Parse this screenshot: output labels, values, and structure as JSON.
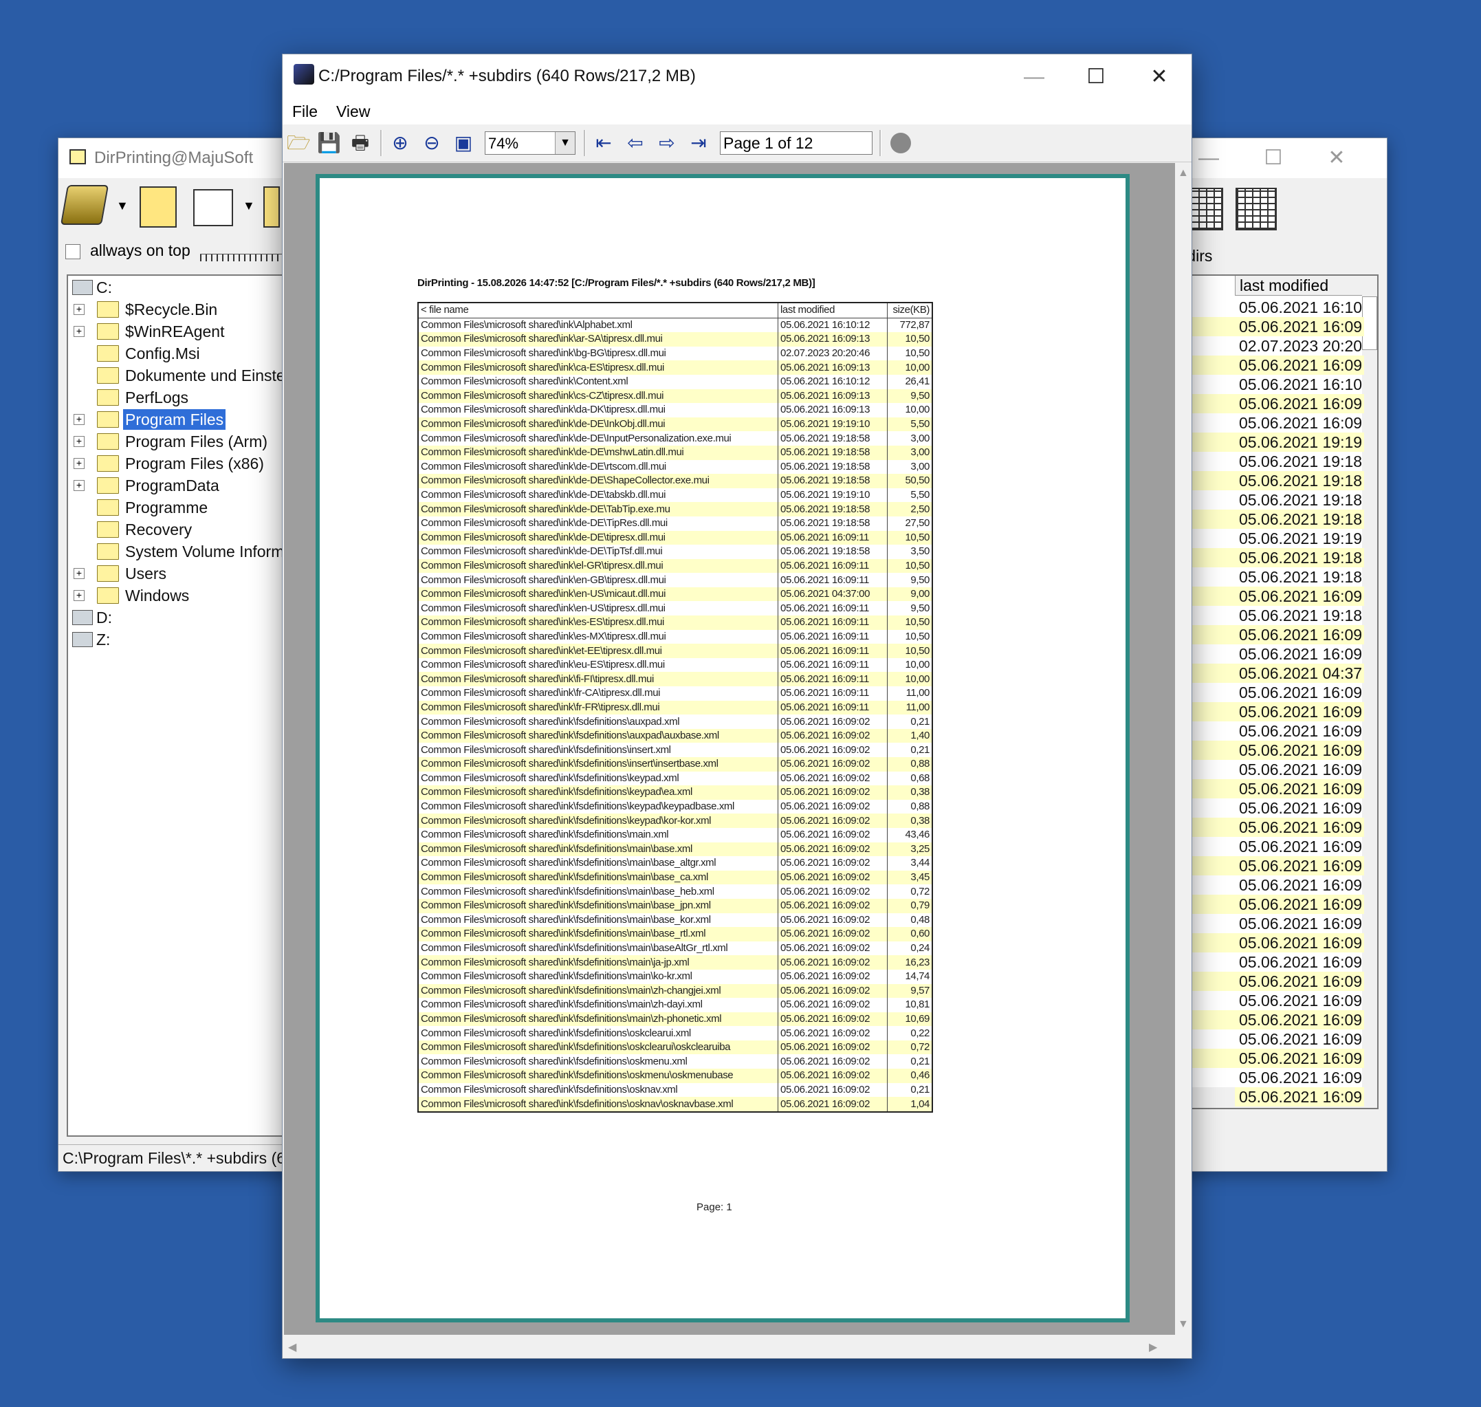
{
  "left_window": {
    "title": "DirPrinting@MajuSoft",
    "always_on_top": "allways on top",
    "status": "C:\\Program Files\\*.* +subdirs (640",
    "tree": [
      {
        "label": "C:",
        "type": "drive"
      },
      {
        "label": "$Recycle.Bin",
        "expandable": true
      },
      {
        "label": "$WinREAgent",
        "expandable": true
      },
      {
        "label": "Config.Msi",
        "expandable": false
      },
      {
        "label": "Dokumente und Einstellu",
        "expandable": false
      },
      {
        "label": "PerfLogs",
        "expandable": false
      },
      {
        "label": "Program Files",
        "expandable": true,
        "selected": true
      },
      {
        "label": "Program Files (Arm)",
        "expandable": true
      },
      {
        "label": "Program Files (x86)",
        "expandable": true
      },
      {
        "label": "ProgramData",
        "expandable": true
      },
      {
        "label": "Programme",
        "expandable": false
      },
      {
        "label": "Recovery",
        "expandable": false
      },
      {
        "label": "System Volume Informati",
        "expandable": false
      },
      {
        "label": "Users",
        "expandable": true
      },
      {
        "label": "Windows",
        "expandable": true
      },
      {
        "label": "D:",
        "type": "drive"
      },
      {
        "label": "Z:",
        "type": "drive"
      }
    ]
  },
  "right_window": {
    "search_label": "earch in subdirs",
    "column_header": "last modified",
    "dates": [
      "05.06.2021 16:10",
      "05.06.2021 16:09",
      "02.07.2023 20:20",
      "05.06.2021 16:09",
      "05.06.2021 16:10",
      "05.06.2021 16:09",
      "05.06.2021 16:09",
      "05.06.2021 19:19",
      "05.06.2021 19:18",
      "05.06.2021 19:18",
      "05.06.2021 19:18",
      "05.06.2021 19:18",
      "05.06.2021 19:19",
      "05.06.2021 19:18",
      "05.06.2021 19:18",
      "05.06.2021 16:09",
      "05.06.2021 19:18",
      "05.06.2021 16:09",
      "05.06.2021 16:09",
      "05.06.2021 04:37",
      "05.06.2021 16:09",
      "05.06.2021 16:09",
      "05.06.2021 16:09",
      "05.06.2021 16:09",
      "05.06.2021 16:09",
      "05.06.2021 16:09",
      "05.06.2021 16:09",
      "05.06.2021 16:09",
      "05.06.2021 16:09",
      "05.06.2021 16:09",
      "05.06.2021 16:09",
      "05.06.2021 16:09",
      "05.06.2021 16:09",
      "05.06.2021 16:09",
      "05.06.2021 16:09",
      "05.06.2021 16:09",
      "05.06.2021 16:09",
      "05.06.2021 16:09",
      "05.06.2021 16:09",
      "05.06.2021 16:09",
      "05.06.2021 16:09",
      "05.06.2021 16:09"
    ],
    "fragments": [
      {
        "row": 8,
        "text": "mui"
      },
      {
        "row": 29,
        "text": "nl"
      },
      {
        "row": 31,
        "text": "nl"
      },
      {
        "row": 34,
        "text": "e.xml"
      },
      {
        "row": 38,
        "text": "l"
      }
    ]
  },
  "main_window": {
    "title": "C:/Program Files/*.* +subdirs (640 Rows/217,2 MB)",
    "menu": [
      "File",
      "View"
    ],
    "zoom": "74%",
    "page_indicator": "Page 1 of 12",
    "report": {
      "title": "DirPrinting - 15.08.2026 14:47:52 [C:/Program Files/*.* +subdirs (640 Rows/217,2 MB)]",
      "headers": [
        "< file name",
        "last modified",
        "size(KB)"
      ],
      "rows": [
        [
          "Common Files\\microsoft shared\\ink\\Alphabet.xml",
          "05.06.2021 16:10:12",
          "772,87"
        ],
        [
          "Common Files\\microsoft shared\\ink\\ar-SA\\tipresx.dll.mui",
          "05.06.2021 16:09:13",
          "10,50"
        ],
        [
          "Common Files\\microsoft shared\\ink\\bg-BG\\tipresx.dll.mui",
          "02.07.2023 20:20:46",
          "10,50"
        ],
        [
          "Common Files\\microsoft shared\\ink\\ca-ES\\tipresx.dll.mui",
          "05.06.2021 16:09:13",
          "10,00"
        ],
        [
          "Common Files\\microsoft shared\\ink\\Content.xml",
          "05.06.2021 16:10:12",
          "26,41"
        ],
        [
          "Common Files\\microsoft shared\\ink\\cs-CZ\\tipresx.dll.mui",
          "05.06.2021 16:09:13",
          "9,50"
        ],
        [
          "Common Files\\microsoft shared\\ink\\da-DK\\tipresx.dll.mui",
          "05.06.2021 16:09:13",
          "10,00"
        ],
        [
          "Common Files\\microsoft shared\\ink\\de-DE\\InkObj.dll.mui",
          "05.06.2021 19:19:10",
          "5,50"
        ],
        [
          "Common Files\\microsoft shared\\ink\\de-DE\\InputPersonalization.exe.mui",
          "05.06.2021 19:18:58",
          "3,00"
        ],
        [
          "Common Files\\microsoft shared\\ink\\de-DE\\mshwLatin.dll.mui",
          "05.06.2021 19:18:58",
          "3,00"
        ],
        [
          "Common Files\\microsoft shared\\ink\\de-DE\\rtscom.dll.mui",
          "05.06.2021 19:18:58",
          "3,00"
        ],
        [
          "Common Files\\microsoft shared\\ink\\de-DE\\ShapeCollector.exe.mui",
          "05.06.2021 19:18:58",
          "50,50"
        ],
        [
          "Common Files\\microsoft shared\\ink\\de-DE\\tabskb.dll.mui",
          "05.06.2021 19:19:10",
          "5,50"
        ],
        [
          "Common Files\\microsoft shared\\ink\\de-DE\\TabTip.exe.mu",
          "05.06.2021 19:18:58",
          "2,50"
        ],
        [
          "Common Files\\microsoft shared\\ink\\de-DE\\TipRes.dll.mui",
          "05.06.2021 19:18:58",
          "27,50"
        ],
        [
          "Common Files\\microsoft shared\\ink\\de-DE\\tipresx.dll.mui",
          "05.06.2021 16:09:11",
          "10,50"
        ],
        [
          "Common Files\\microsoft shared\\ink\\de-DE\\TipTsf.dll.mui",
          "05.06.2021 19:18:58",
          "3,50"
        ],
        [
          "Common Files\\microsoft shared\\ink\\el-GR\\tipresx.dll.mui",
          "05.06.2021 16:09:11",
          "10,50"
        ],
        [
          "Common Files\\microsoft shared\\ink\\en-GB\\tipresx.dll.mui",
          "05.06.2021 16:09:11",
          "9,50"
        ],
        [
          "Common Files\\microsoft shared\\ink\\en-US\\micaut.dll.mui",
          "05.06.2021 04:37:00",
          "9,00"
        ],
        [
          "Common Files\\microsoft shared\\ink\\en-US\\tipresx.dll.mui",
          "05.06.2021 16:09:11",
          "9,50"
        ],
        [
          "Common Files\\microsoft shared\\ink\\es-ES\\tipresx.dll.mui",
          "05.06.2021 16:09:11",
          "10,50"
        ],
        [
          "Common Files\\microsoft shared\\ink\\es-MX\\tipresx.dll.mui",
          "05.06.2021 16:09:11",
          "10,50"
        ],
        [
          "Common Files\\microsoft shared\\ink\\et-EE\\tipresx.dll.mui",
          "05.06.2021 16:09:11",
          "10,50"
        ],
        [
          "Common Files\\microsoft shared\\ink\\eu-ES\\tipresx.dll.mui",
          "05.06.2021 16:09:11",
          "10,00"
        ],
        [
          "Common Files\\microsoft shared\\ink\\fi-FI\\tipresx.dll.mui",
          "05.06.2021 16:09:11",
          "10,00"
        ],
        [
          "Common Files\\microsoft shared\\ink\\fr-CA\\tipresx.dll.mui",
          "05.06.2021 16:09:11",
          "11,00"
        ],
        [
          "Common Files\\microsoft shared\\ink\\fr-FR\\tipresx.dll.mui",
          "05.06.2021 16:09:11",
          "11,00"
        ],
        [
          "Common Files\\microsoft shared\\ink\\fsdefinitions\\auxpad.xml",
          "05.06.2021 16:09:02",
          "0,21"
        ],
        [
          "Common Files\\microsoft shared\\ink\\fsdefinitions\\auxpad\\auxbase.xml",
          "05.06.2021 16:09:02",
          "1,40"
        ],
        [
          "Common Files\\microsoft shared\\ink\\fsdefinitions\\insert.xml",
          "05.06.2021 16:09:02",
          "0,21"
        ],
        [
          "Common Files\\microsoft shared\\ink\\fsdefinitions\\insert\\insertbase.xml",
          "05.06.2021 16:09:02",
          "0,88"
        ],
        [
          "Common Files\\microsoft shared\\ink\\fsdefinitions\\keypad.xml",
          "05.06.2021 16:09:02",
          "0,68"
        ],
        [
          "Common Files\\microsoft shared\\ink\\fsdefinitions\\keypad\\ea.xml",
          "05.06.2021 16:09:02",
          "0,38"
        ],
        [
          "Common Files\\microsoft shared\\ink\\fsdefinitions\\keypad\\keypadbase.xml",
          "05.06.2021 16:09:02",
          "0,88"
        ],
        [
          "Common Files\\microsoft shared\\ink\\fsdefinitions\\keypad\\kor-kor.xml",
          "05.06.2021 16:09:02",
          "0,38"
        ],
        [
          "Common Files\\microsoft shared\\ink\\fsdefinitions\\main.xml",
          "05.06.2021 16:09:02",
          "43,46"
        ],
        [
          "Common Files\\microsoft shared\\ink\\fsdefinitions\\main\\base.xml",
          "05.06.2021 16:09:02",
          "3,25"
        ],
        [
          "Common Files\\microsoft shared\\ink\\fsdefinitions\\main\\base_altgr.xml",
          "05.06.2021 16:09:02",
          "3,44"
        ],
        [
          "Common Files\\microsoft shared\\ink\\fsdefinitions\\main\\base_ca.xml",
          "05.06.2021 16:09:02",
          "3,45"
        ],
        [
          "Common Files\\microsoft shared\\ink\\fsdefinitions\\main\\base_heb.xml",
          "05.06.2021 16:09:02",
          "0,72"
        ],
        [
          "Common Files\\microsoft shared\\ink\\fsdefinitions\\main\\base_jpn.xml",
          "05.06.2021 16:09:02",
          "0,79"
        ],
        [
          "Common Files\\microsoft shared\\ink\\fsdefinitions\\main\\base_kor.xml",
          "05.06.2021 16:09:02",
          "0,48"
        ],
        [
          "Common Files\\microsoft shared\\ink\\fsdefinitions\\main\\base_rtl.xml",
          "05.06.2021 16:09:02",
          "0,60"
        ],
        [
          "Common Files\\microsoft shared\\ink\\fsdefinitions\\main\\baseAltGr_rtl.xml",
          "05.06.2021 16:09:02",
          "0,24"
        ],
        [
          "Common Files\\microsoft shared\\ink\\fsdefinitions\\main\\ja-jp.xml",
          "05.06.2021 16:09:02",
          "16,23"
        ],
        [
          "Common Files\\microsoft shared\\ink\\fsdefinitions\\main\\ko-kr.xml",
          "05.06.2021 16:09:02",
          "14,74"
        ],
        [
          "Common Files\\microsoft shared\\ink\\fsdefinitions\\main\\zh-changjei.xml",
          "05.06.2021 16:09:02",
          "9,57"
        ],
        [
          "Common Files\\microsoft shared\\ink\\fsdefinitions\\main\\zh-dayi.xml",
          "05.06.2021 16:09:02",
          "10,81"
        ],
        [
          "Common Files\\microsoft shared\\ink\\fsdefinitions\\main\\zh-phonetic.xml",
          "05.06.2021 16:09:02",
          "10,69"
        ],
        [
          "Common Files\\microsoft shared\\ink\\fsdefinitions\\oskclearui.xml",
          "05.06.2021 16:09:02",
          "0,22"
        ],
        [
          "Common Files\\microsoft shared\\ink\\fsdefinitions\\oskclearui\\oskclearuiba",
          "05.06.2021 16:09:02",
          "0,72"
        ],
        [
          "Common Files\\microsoft shared\\ink\\fsdefinitions\\oskmenu.xml",
          "05.06.2021 16:09:02",
          "0,21"
        ],
        [
          "Common Files\\microsoft shared\\ink\\fsdefinitions\\oskmenu\\oskmenubase",
          "05.06.2021 16:09:02",
          "0,46"
        ],
        [
          "Common Files\\microsoft shared\\ink\\fsdefinitions\\osknav.xml",
          "05.06.2021 16:09:02",
          "0,21"
        ],
        [
          "Common Files\\microsoft shared\\ink\\fsdefinitions\\osknav\\osknavbase.xml",
          "05.06.2021 16:09:02",
          "1,04"
        ]
      ],
      "footer": "Page: 1"
    }
  },
  "colors": {
    "desktop": "#2a5ca6",
    "row_highlight": "#ffffc8",
    "page_frame": "#2d8a84",
    "selection": "#2f6ed8"
  }
}
